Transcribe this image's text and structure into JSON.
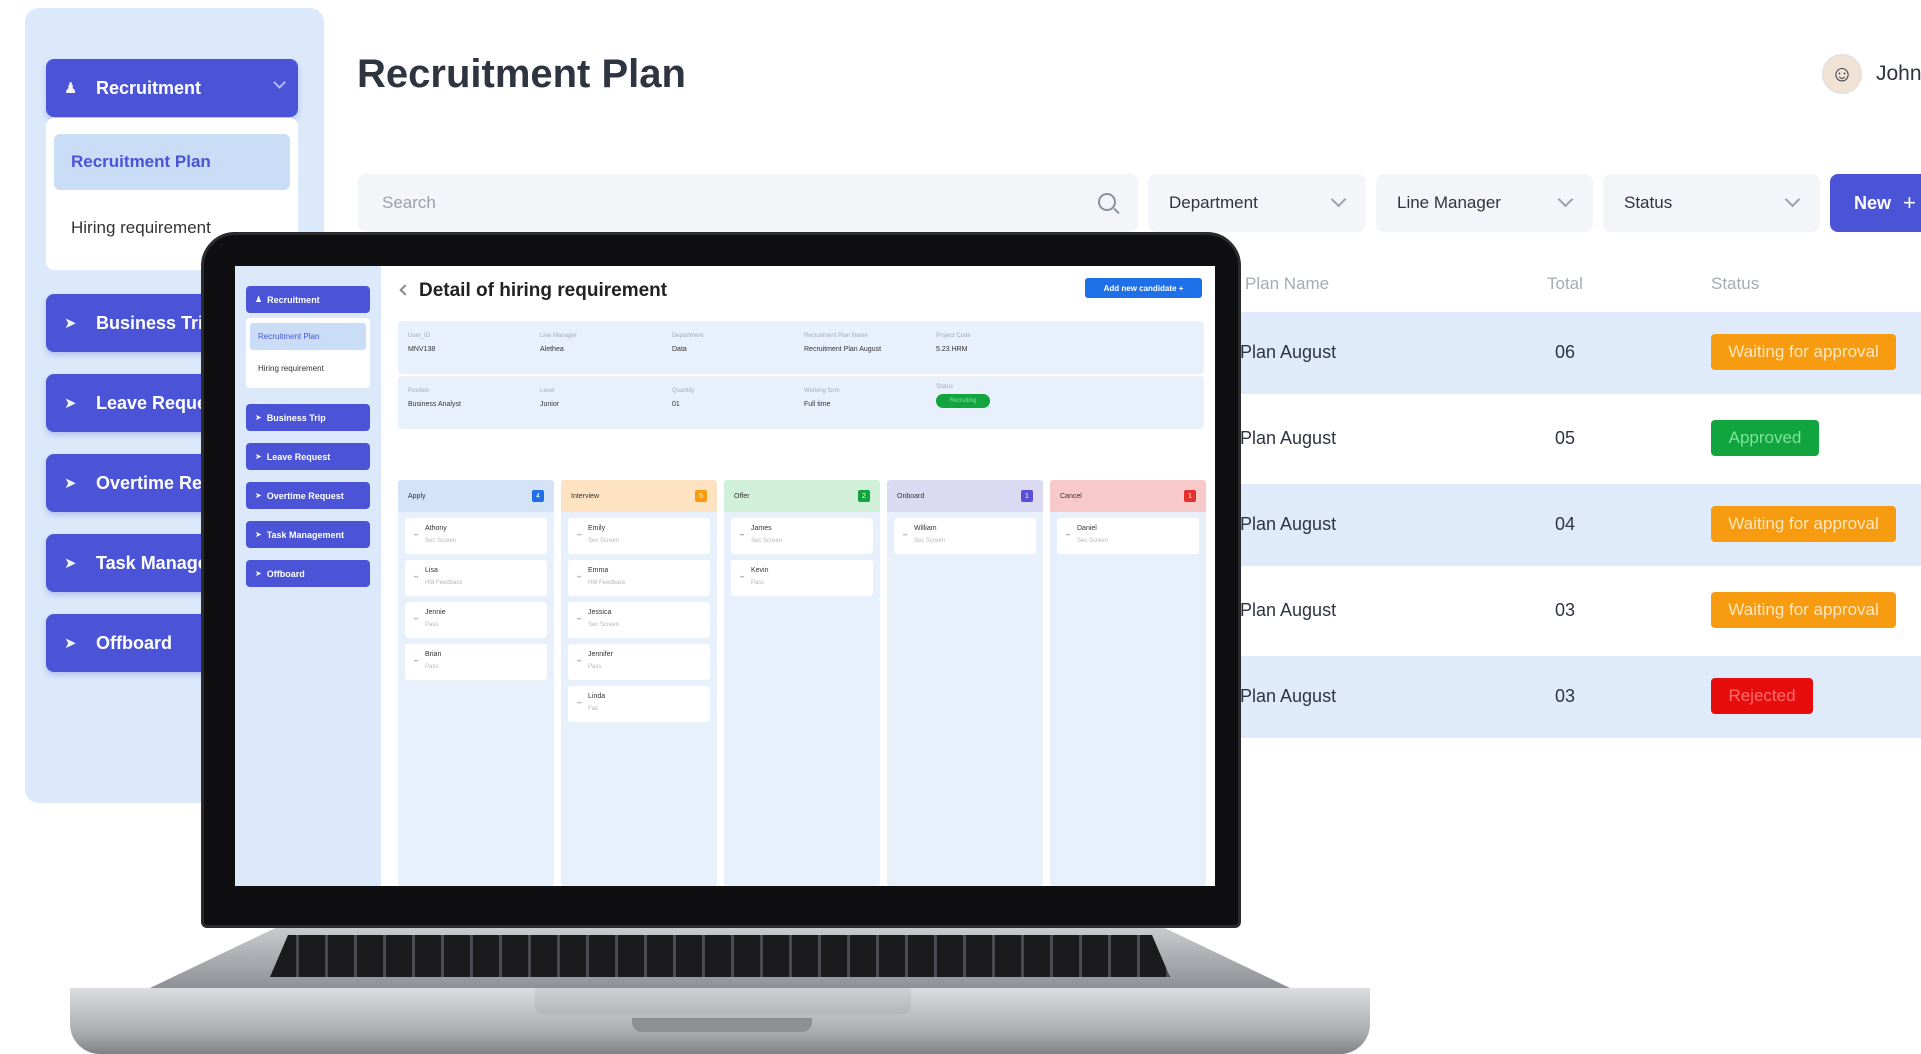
{
  "sidebar": {
    "recruitment_label": "Recruitment",
    "sub_items": [
      "Recruitment Plan",
      "Hiring requirement"
    ],
    "items": [
      "Business Trip",
      "Leave Request",
      "Overtime Request",
      "Task Management",
      "Offboard"
    ]
  },
  "header": {
    "title": "Recruitment Plan",
    "user_name": "John"
  },
  "toolbar": {
    "search_placeholder": "Search",
    "filters": [
      "Department",
      "Line Manager",
      "Status"
    ],
    "new_label": "New"
  },
  "table": {
    "columns": [
      "Plan Name",
      "Total",
      "Status"
    ],
    "rows": [
      {
        "plan": "Plan August",
        "total": "06",
        "status": "Waiting for approval",
        "kind": "waiting"
      },
      {
        "plan": "Plan August",
        "total": "05",
        "status": "Approved",
        "kind": "approved"
      },
      {
        "plan": "Plan August",
        "total": "04",
        "status": "Waiting for approval",
        "kind": "waiting"
      },
      {
        "plan": "Plan August",
        "total": "03",
        "status": "Waiting for approval",
        "kind": "waiting"
      },
      {
        "plan": "Plan August",
        "total": "03",
        "status": "Rejected",
        "kind": "rejected"
      }
    ]
  },
  "detail": {
    "sidebar": {
      "recruitment_label": "Recruitment",
      "sub_items": [
        "Recruitment Plan",
        "Hiring requirement"
      ],
      "items": [
        "Business Trip",
        "Leave Request",
        "Overtime Request",
        "Task Management",
        "Offboard"
      ]
    },
    "title": "Detail of hiring requirement",
    "add_button": "Add new candidate",
    "info_row1": [
      {
        "label": "User_ID",
        "value": "MNV138"
      },
      {
        "label": "Line Manager",
        "value": "Alethea"
      },
      {
        "label": "Department",
        "value": "Data"
      },
      {
        "label": "Recruitment Plan Name",
        "value": "Recruitment Plan August"
      },
      {
        "label": "Project Code",
        "value": "5.23.HRM"
      }
    ],
    "info_row2": [
      {
        "label": "Position",
        "value": "Business Analyst"
      },
      {
        "label": "Level",
        "value": "Junior"
      },
      {
        "label": "Quantity",
        "value": "01"
      },
      {
        "label": "Working form",
        "value": "Full time"
      },
      {
        "label": "Status",
        "value": "Recruiting"
      }
    ],
    "columns": [
      {
        "name": "Apply",
        "count": "4",
        "head_color": "#d4e3f8",
        "count_color": "#1f6fe8",
        "cards": [
          {
            "name": "Athony",
            "stage": "Sec Screen"
          },
          {
            "name": "Lisa",
            "stage": "HM Feedback"
          },
          {
            "name": "Jennie",
            "stage": "Pass"
          },
          {
            "name": "Brian",
            "stage": "Pass"
          }
        ]
      },
      {
        "name": "Interview",
        "count": "5",
        "head_color": "#fde3c2",
        "count_color": "#f79b10",
        "cards": [
          {
            "name": "Emily",
            "stage": "Sec Screen"
          },
          {
            "name": "Emma",
            "stage": "HM Feedback"
          },
          {
            "name": "Jessica",
            "stage": "Sec Screen"
          },
          {
            "name": "Jennifer",
            "stage": "Pass"
          },
          {
            "name": "Linda",
            "stage": "Fail"
          }
        ]
      },
      {
        "name": "Offer",
        "count": "2",
        "head_color": "#d1f0d9",
        "count_color": "#12a43e",
        "cards": [
          {
            "name": "James",
            "stage": "Sec Screen"
          },
          {
            "name": "Kevin",
            "stage": "Pass"
          }
        ]
      },
      {
        "name": "Onboard",
        "count": "1",
        "head_color": "#dcdaf2",
        "count_color": "#5b4fd6",
        "cards": [
          {
            "name": "William",
            "stage": "Sec Screen"
          }
        ]
      },
      {
        "name": "Cancel",
        "count": "1",
        "head_color": "#f7c9c9",
        "count_color": "#e53030",
        "cards": [
          {
            "name": "Daniel",
            "stage": "Sec Screen"
          }
        ]
      }
    ]
  },
  "colors": {
    "accent": "#4b53d7",
    "sidebar_bg": "#dbe9fb",
    "waiting": "#f79b10",
    "approved": "#12a43e",
    "rejected": "#e80d0d",
    "detail_button": "#1f6fe8"
  }
}
